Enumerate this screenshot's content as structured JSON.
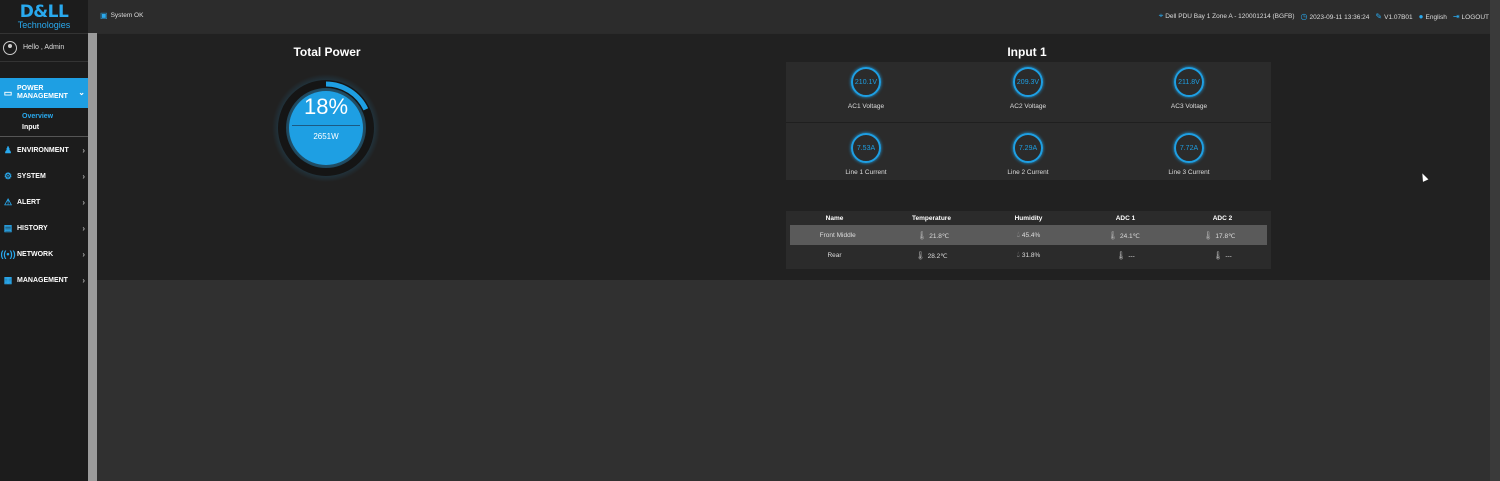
{
  "sidebar": {
    "brand": "D&LL",
    "brand_sub": "Technologies",
    "greeting": "Hello , Admin",
    "menu": [
      {
        "label": "POWER MANAGEMENT",
        "icon": "monitor-icon",
        "active": true
      },
      {
        "label": "ENVIRONMENT",
        "icon": "people-icon"
      },
      {
        "label": "SYSTEM",
        "icon": "gear-icon"
      },
      {
        "label": "ALERT",
        "icon": "alert-icon"
      },
      {
        "label": "HISTORY",
        "icon": "calendar-icon"
      },
      {
        "label": "NETWORK",
        "icon": "signal-icon"
      },
      {
        "label": "MANAGEMENT",
        "icon": "dashboard-icon"
      }
    ],
    "submenu": [
      "Overview",
      "Input"
    ]
  },
  "topbar": {
    "status": "System OK",
    "location": "Dell PDU Bay 1 Zone A - 120001214 (BGFB)",
    "datetime": "2023-09-11 13:36:24",
    "version": "V1.07B01",
    "language": "English",
    "logout": "LOGOUT"
  },
  "total_power": {
    "title": "Total Power",
    "percent_label": "18%",
    "percent": 18,
    "watts": "2651W"
  },
  "input": {
    "title": "Input 1",
    "meters": [
      {
        "value": "210.1V",
        "label": "AC1 Voltage"
      },
      {
        "value": "209.3V",
        "label": "AC2 Voltage"
      },
      {
        "value": "211.8V",
        "label": "AC3 Voltage"
      },
      {
        "value": "7.53A",
        "label": "Line 1 Current"
      },
      {
        "value": "7.29A",
        "label": "Line 2 Current"
      },
      {
        "value": "7.72A",
        "label": "Line 3 Current"
      }
    ]
  },
  "sensors": {
    "headers": [
      "Name",
      "Temperature",
      "Humidity",
      "ADC 1",
      "ADC 2"
    ],
    "rows": [
      [
        "Front Middle",
        "21.8℃",
        "45.4%",
        "24.1℃",
        "17.8℃"
      ],
      [
        "Rear",
        "28.2℃",
        "31.8%",
        "---",
        "---"
      ]
    ]
  },
  "colors": {
    "accent": "#1e9fe3",
    "sidebar": "#1c1c1c",
    "panel": "#212121"
  }
}
